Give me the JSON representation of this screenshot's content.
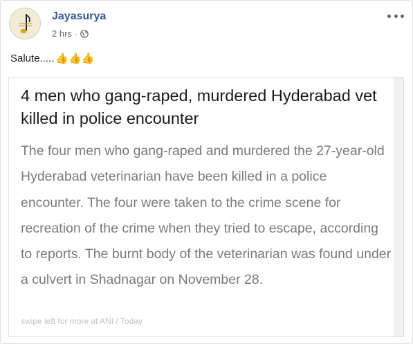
{
  "post": {
    "author": "Jayasurya",
    "timestamp": "2 hrs",
    "separator": "·",
    "privacy_icon": "globe-icon",
    "caption_text": "Salute.....",
    "caption_emoji": "👍👍👍",
    "more_icon": "ellipsis-icon"
  },
  "card": {
    "headline": "4 men who gang-raped, murdered Hyderabad vet killed in police encounter",
    "body": "The four men who gang-raped and murdered the 27-year-old Hyderabad veterinarian have been killed in a police encounter. The four were taken to the crime scene for recreation of the crime when they tried to escape, according to reports. The burnt body of the veterinarian was found under a culvert in Shadnagar on November 28.",
    "footer": "swipe left for more at ANI / Today"
  },
  "colors": {
    "author": "#385898",
    "meta": "#616770",
    "body_text": "#7a7a7a",
    "headline_text": "#1b1b1b",
    "thumbs": "#f5b82e"
  }
}
